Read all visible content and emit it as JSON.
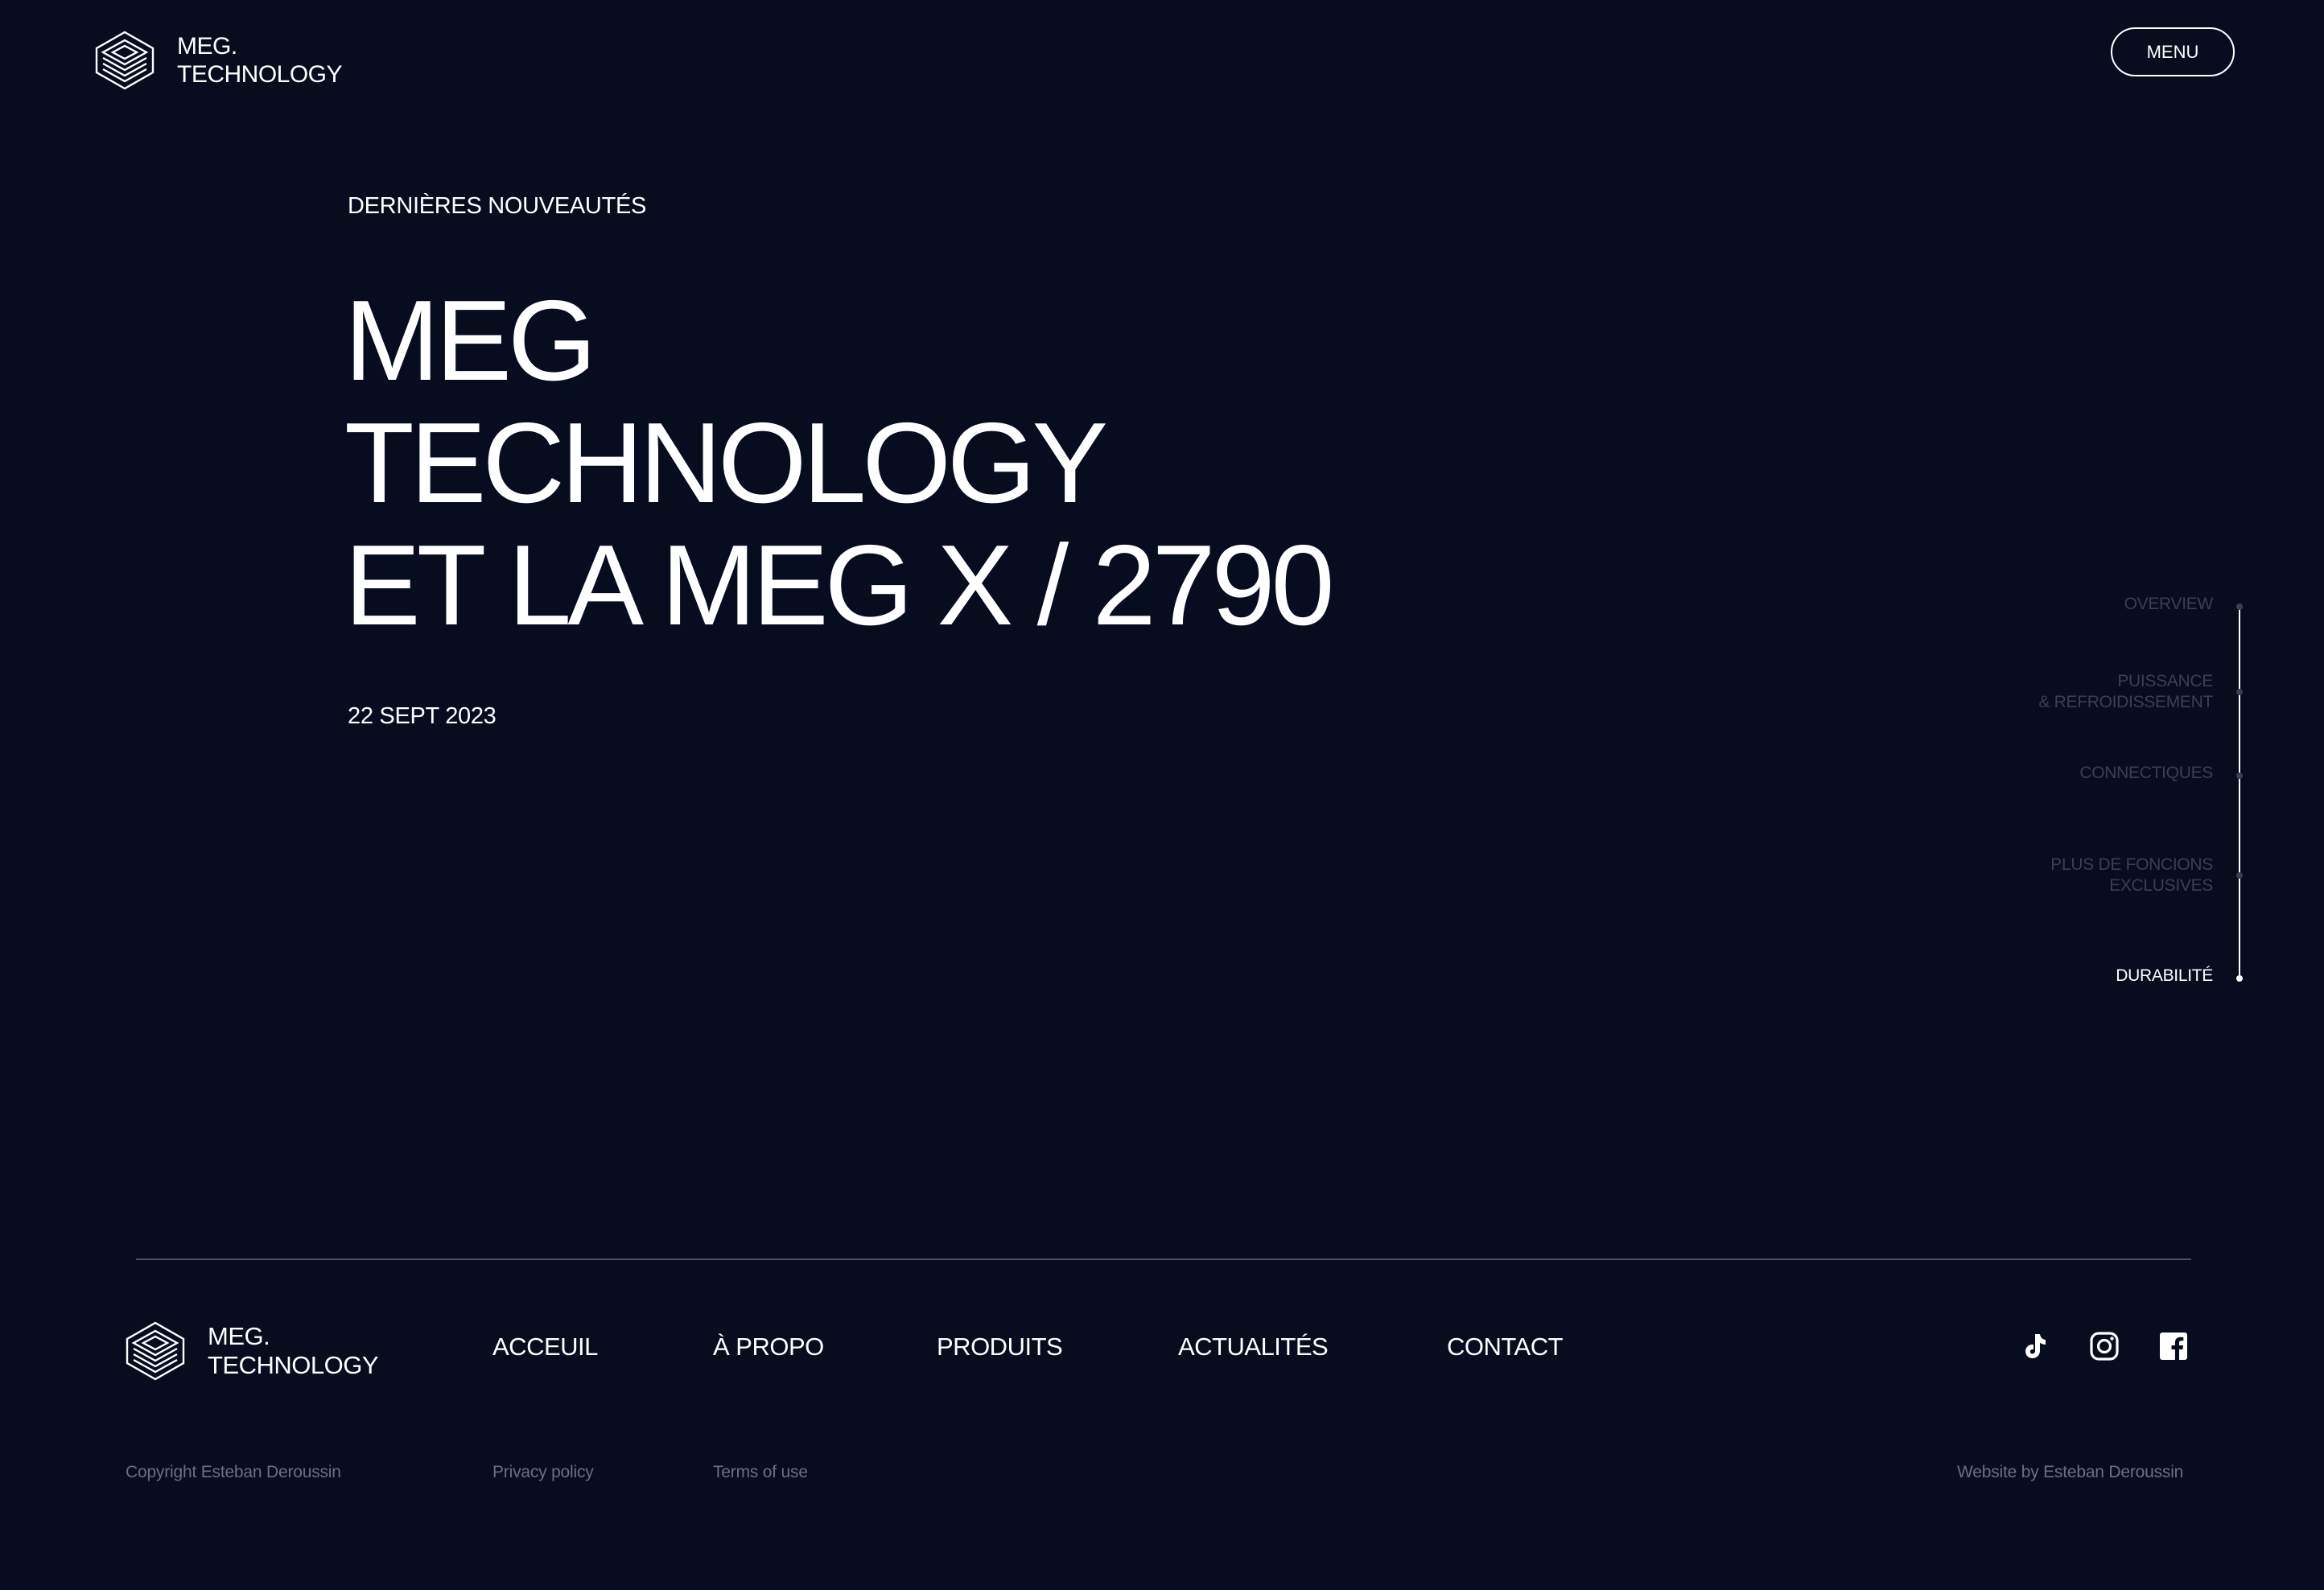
{
  "header": {
    "brand_line1": "MEG.",
    "brand_line2": "TECHNOLOGY",
    "menu_label": "MENU"
  },
  "hero": {
    "eyebrow": "DERNIÈRES NOUVEAUTÉS",
    "title_lines": [
      "MEG",
      "TECHNOLOGY",
      "ET LA MEG X / 2790"
    ],
    "date": "22 SEPT 2023"
  },
  "side_nav": {
    "items": [
      {
        "label": "OVERVIEW",
        "label2": ""
      },
      {
        "label": "PUISSANCE",
        "label2": "& REFROIDISSEMENT"
      },
      {
        "label": "CONNECTIQUES",
        "label2": ""
      },
      {
        "label": "PLUS DE FONCIONS",
        "label2": "EXCLUSIVES"
      },
      {
        "label": "DURABILITÉ",
        "label2": ""
      }
    ],
    "active": "DURABILITÉ"
  },
  "footer": {
    "brand_line1": "MEG.",
    "brand_line2": "TECHNOLOGY",
    "nav": [
      "ACCEUIL",
      "À PROPO",
      "PRODUITS",
      "ACTUALITÉS",
      "CONTACT"
    ],
    "social_icons": [
      "tiktok-icon",
      "instagram-icon",
      "facebook-icon"
    ],
    "copyright": "Copyright Esteban Deroussin",
    "privacy": "Privacy policy",
    "terms": "Terms of use",
    "credit": "Website by Esteban Deroussin"
  },
  "colors": {
    "background": "#070c1f",
    "text": "#ffffff",
    "muted": "#3a4054",
    "legal": "#6a7083"
  }
}
